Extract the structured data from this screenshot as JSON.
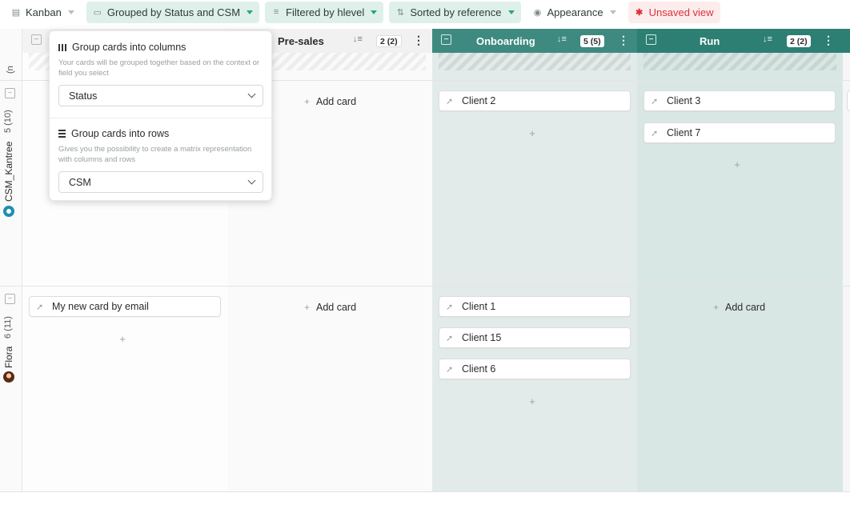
{
  "toolbar": {
    "view": "Kanban",
    "grouped": "Grouped by Status and CSM",
    "filtered": "Filtered by hlevel",
    "sorted": "Sorted by reference",
    "appearance": "Appearance",
    "unsaved": "Unsaved view"
  },
  "columns": [
    {
      "name": "Pre-sales",
      "count": "2 (2)"
    },
    {
      "name": "Onboarding",
      "count": "5 (5)"
    },
    {
      "name": "Run",
      "count": "2 (2)"
    }
  ],
  "rows": [
    {
      "partial_label": "(n",
      "name": "CSM_Kantree",
      "count": "5 (10)"
    },
    {
      "name": "Flora",
      "count": "6 (11)"
    }
  ],
  "cards": {
    "onboarding_row1": [
      "Client 2"
    ],
    "run_row1": [
      "Client 3",
      "Client 7"
    ],
    "first_row2": [
      "My new card by email"
    ],
    "onboarding_row2": [
      "Client 1",
      "Client 15",
      "Client 6"
    ]
  },
  "add_card": "Add card",
  "popup": {
    "columns_title": "Group cards into columns",
    "columns_desc": "Your cards will be grouped together based on the context or field you select",
    "columns_value": "Status",
    "rows_title": "Group cards into rows",
    "rows_desc": "Gives you the possibility to create a matrix representation with columns and rows",
    "rows_value": "CSM"
  },
  "colors": {
    "onboarding_head": "#3e8a80",
    "onboarding_bg": "#e3ebea",
    "run_head": "#2d7f73",
    "run_bg": "#d9e7e4",
    "accent_green": "#2aa86f",
    "unsaved_red": "#d8333a"
  }
}
